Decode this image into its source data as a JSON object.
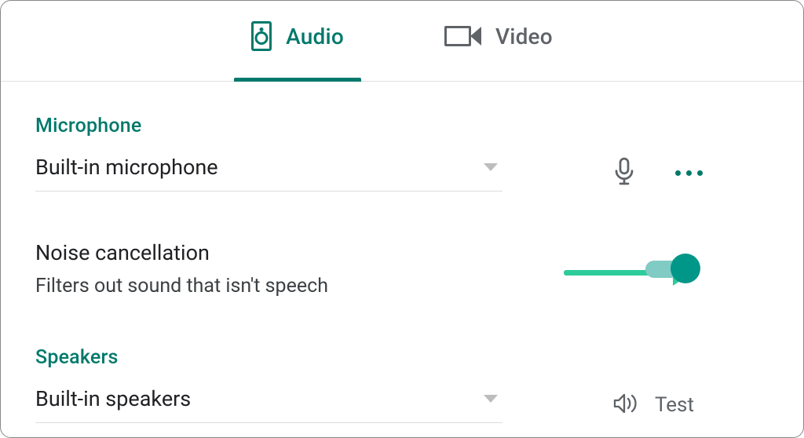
{
  "tabs": {
    "audio": "Audio",
    "video": "Video"
  },
  "microphone": {
    "heading": "Microphone",
    "value": "Built-in microphone"
  },
  "noise": {
    "title": "Noise cancellation",
    "desc": "Filters out sound that isn't speech",
    "enabled": true
  },
  "speakers": {
    "heading": "Speakers",
    "value": "Built-in speakers",
    "test_label": "Test"
  },
  "colors": {
    "accent": "#00796b",
    "arrow": "#2ecc9b"
  }
}
